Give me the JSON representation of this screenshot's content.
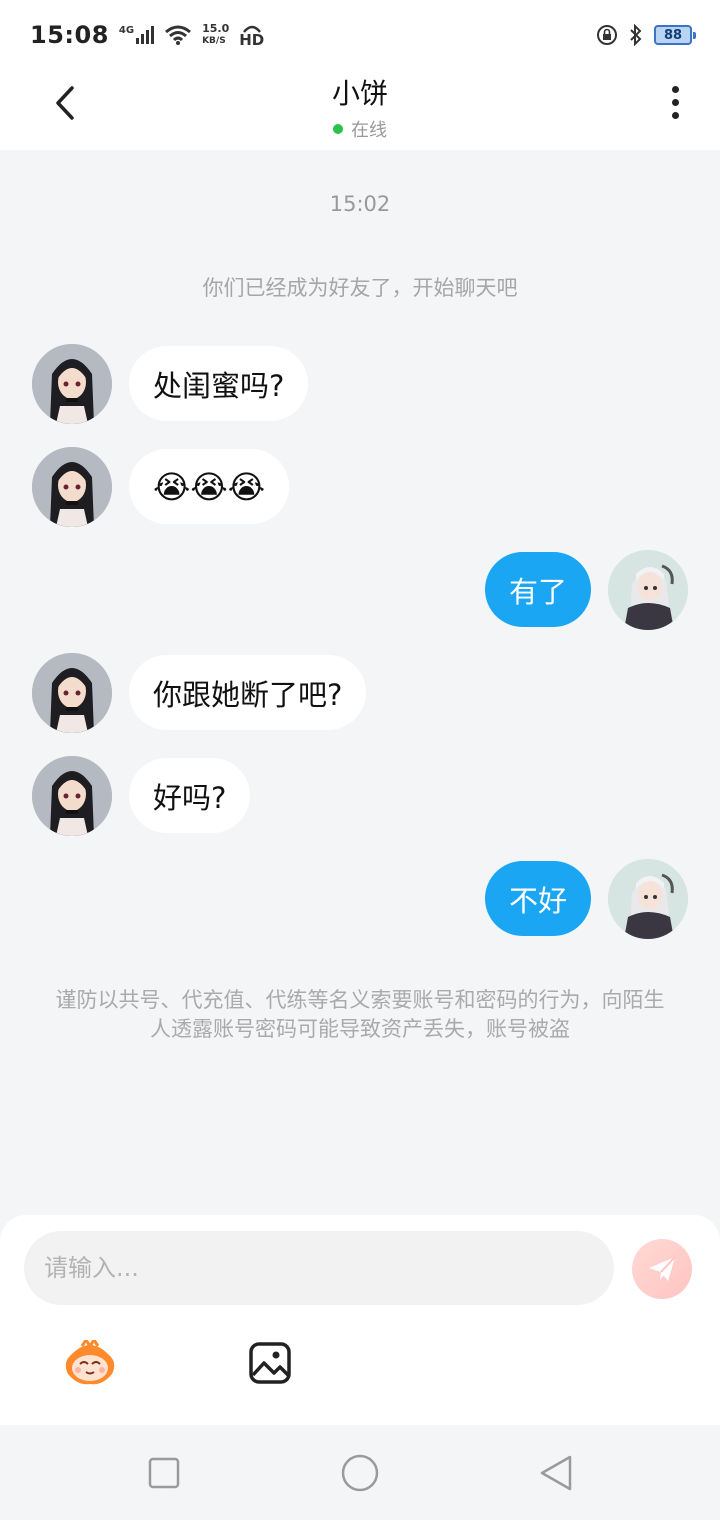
{
  "status_bar": {
    "time": "15:08",
    "network": "4G",
    "speed_value": "15.0",
    "speed_unit": "KB/S",
    "hd": "HD",
    "battery": "88"
  },
  "header": {
    "title": "小饼",
    "presence": "在线"
  },
  "chat": {
    "timestamp": "15:02",
    "system_notice": "你们已经成为好友了，开始聊天吧",
    "messages": [
      {
        "side": "in",
        "text": "处闺蜜吗?"
      },
      {
        "side": "in",
        "text": "😭😭😭"
      },
      {
        "side": "out",
        "text": "有了"
      },
      {
        "side": "in",
        "text": "你跟她断了吧?"
      },
      {
        "side": "in",
        "text": "好吗?"
      },
      {
        "side": "out",
        "text": "不好"
      }
    ],
    "warning": "谨防以共号、代充值、代练等名义索要账号和密码的行为，向陌生人透露账号密码可能导致资产丢失，账号被盗"
  },
  "composer": {
    "placeholder": "请输入..."
  },
  "colors": {
    "outgoing_bubble": "#1aa6f3",
    "online_dot": "#2bc24a",
    "background": "#f4f5f7"
  },
  "icons": {
    "back": "chevron-left-icon",
    "more": "more-vertical-icon",
    "send": "paper-plane-icon",
    "sticker": "sticker-face-icon",
    "image": "image-icon",
    "nav": [
      "square-icon",
      "circle-icon",
      "triangle-back-icon"
    ]
  }
}
